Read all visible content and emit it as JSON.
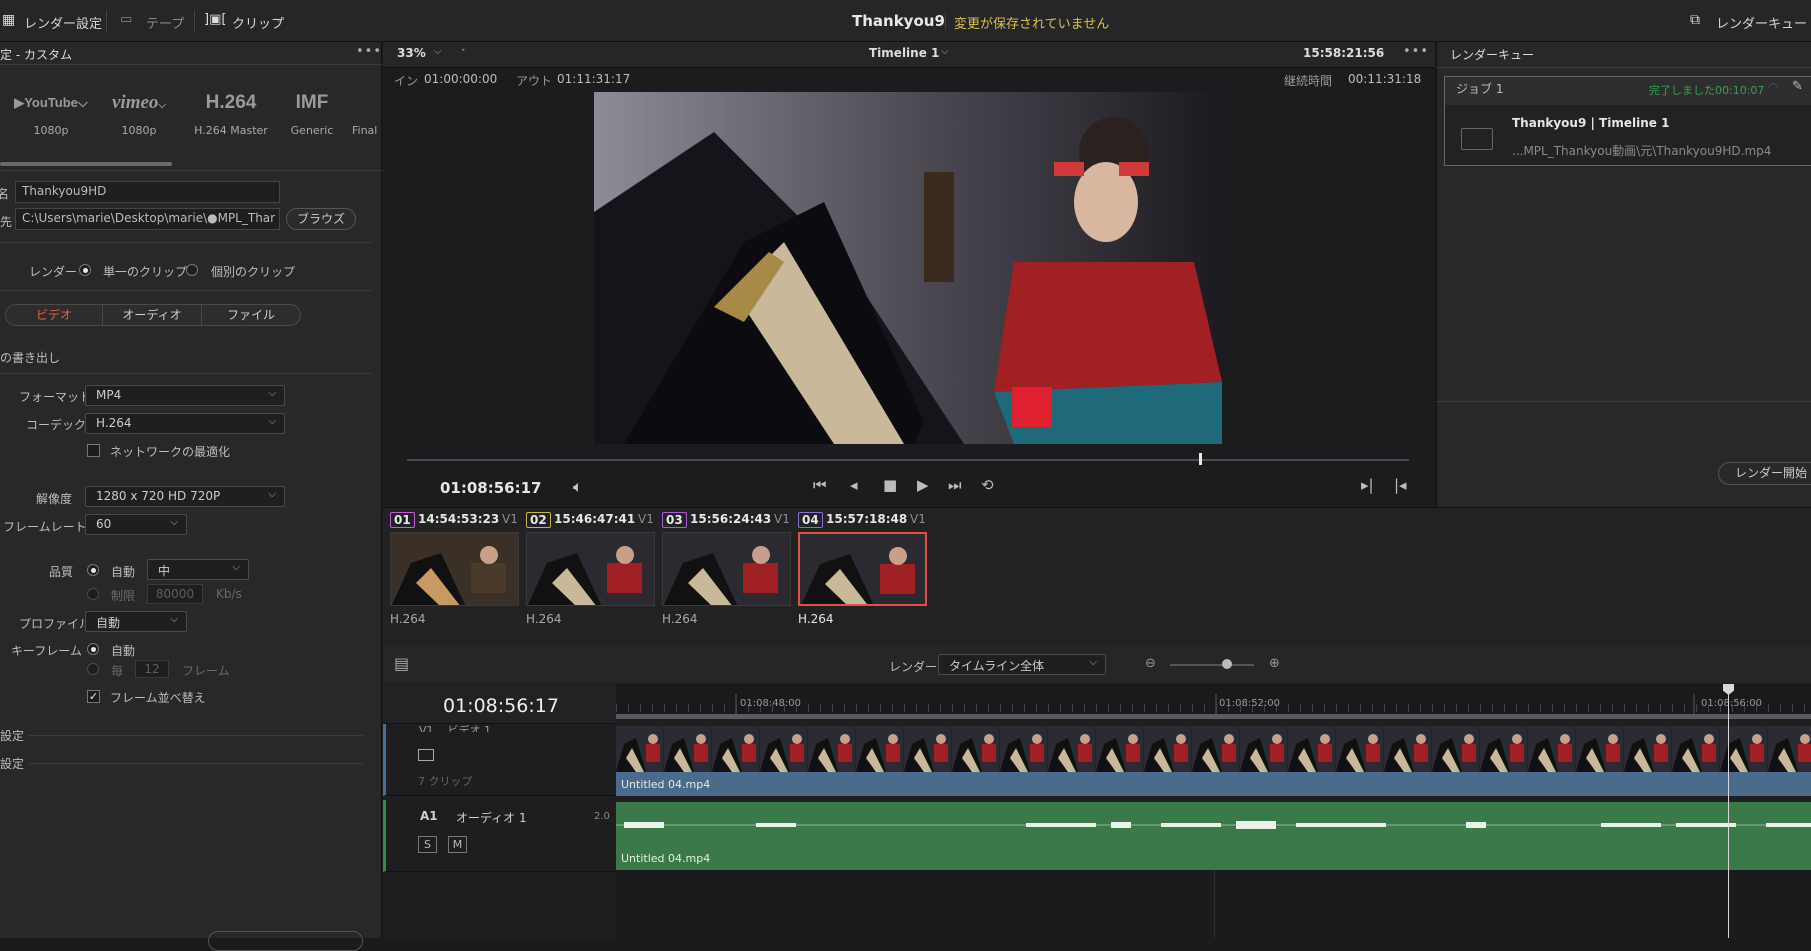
{
  "topbar": {
    "render_settings": "レンダー設定",
    "tape": "テープ",
    "clip": "クリップ",
    "project_title": "Thankyou9",
    "unsaved": "変更が保存されていません",
    "render_queue": "レンダーキュー"
  },
  "left": {
    "header": "定 - カスタム",
    "presets": [
      {
        "name": "YouTube",
        "res": "1080p"
      },
      {
        "name": "vimeo",
        "res": "1080p"
      },
      {
        "name": "H.264",
        "res": "H.264 Master"
      },
      {
        "name": "IMF",
        "res": "Generic"
      },
      {
        "name": "",
        "res": "Final"
      }
    ],
    "filename_label": "ル名",
    "filename": "Thankyou9HD",
    "location_label": "先",
    "location": "C:\\Users\\marie\\Desktop\\marie\\●MPL_Thar",
    "browse": "ブラウズ",
    "render_label": "レンダー",
    "single_clip": "単一のクリップ",
    "individual_clips": "個別のクリップ",
    "tabs": [
      "ビデオ",
      "オーディオ",
      "ファイル"
    ],
    "export_label": "の書き出し",
    "format_label": "フォーマット",
    "format": "MP4",
    "codec_label": "コーデック",
    "codec": "H.264",
    "network_opt": "ネットワークの最適化",
    "resolution_label": "解像度",
    "resolution": "1280 x 720 HD 720P",
    "framerate_label": "フレームレート",
    "framerate": "60",
    "quality_label": "品質",
    "auto": "自動",
    "quality": "中",
    "limit": "制限",
    "limit_value": "80000",
    "kbs": "Kb/s",
    "profile_label": "プロファイル",
    "profile": "自動",
    "keyframe_label": "キーフレーム",
    "keyframe_auto": "自動",
    "keyframe_every": "毎",
    "keyframe_value": "12",
    "frame_unit": "フレーム",
    "frame_reorder": "フレーム並べ替え",
    "setting1": "設定",
    "setting2": "設定"
  },
  "viewer": {
    "zoom": "33%",
    "timeline_name": "Timeline 1",
    "timecode_top": "15:58:21:56",
    "in_label": "イン",
    "in_tc": "01:00:00:00",
    "out_label": "アウト",
    "out_tc": "01:11:31:17",
    "duration_label": "継続時間",
    "duration": "00:11:31:18",
    "current_tc": "01:08:56:17",
    "scrub_position": 0.79
  },
  "queue": {
    "title": "レンダーキュー",
    "job": "ジョブ 1",
    "status": "完了しました00:10:07",
    "job_title": "Thankyou9 | Timeline 1",
    "job_path": "...MPL_Thankyou動画\\元\\Thankyou9HD.mp4",
    "start_render": "レンダー開始"
  },
  "clips": [
    {
      "num": "01",
      "tc": "14:54:53:23",
      "track": "V1",
      "codec": "H.264",
      "color": "#c85bd6"
    },
    {
      "num": "02",
      "tc": "15:46:47:41",
      "track": "V1",
      "codec": "H.264",
      "color": "#c9b640"
    },
    {
      "num": "03",
      "tc": "15:56:24:43",
      "track": "V1",
      "codec": "H.264",
      "color": "#a85bd6"
    },
    {
      "num": "04",
      "tc": "15:57:18:48",
      "track": "V1",
      "codec": "H.264",
      "color": "#8a6bd6"
    }
  ],
  "timeline": {
    "render_label": "レンダー",
    "render_range": "タイムライン全体",
    "timecode": "01:08:56:17",
    "ruler": [
      "01:08:48:00",
      "01:08:52:00",
      "01:08:56:00"
    ],
    "v1_label": "V1",
    "v1_name": "ビデオ 1",
    "v1_clips": "7 クリップ",
    "v1_clip_name": "Untitled 04.mp4",
    "a1_label": "A1",
    "a1_name": "オーディオ 1",
    "a1_channels": "2.0",
    "a1_clip_name": "Untitled 04.mp4",
    "solo": "S",
    "mute": "M"
  }
}
